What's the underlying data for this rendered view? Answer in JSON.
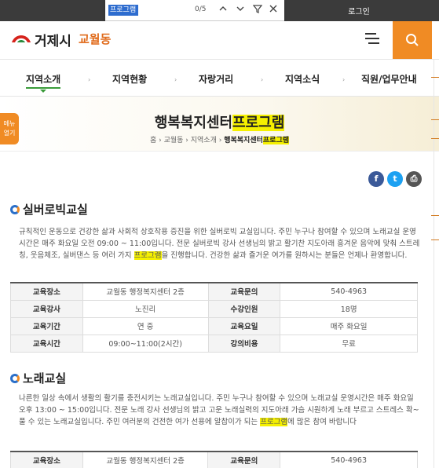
{
  "topbar": {
    "login_label": "로그인"
  },
  "findbar": {
    "query": "프로그램",
    "count": "0/5"
  },
  "header": {
    "city": "거제시",
    "dong": "교월동"
  },
  "nav": {
    "items": [
      "지역소개",
      "지역현황",
      "자랑거리",
      "지역소식",
      "직원/업무안내"
    ]
  },
  "hero": {
    "menu_tab": [
      "메뉴",
      "열기"
    ],
    "title_pre": "행복복지센터",
    "title_hl": "프로그램",
    "breadcrumb": [
      "홈",
      "교월동",
      "지역소개"
    ],
    "breadcrumb_current_pre": "행복복지센터",
    "breadcrumb_current_hl": "프로그램"
  },
  "share": {
    "facebook": "f",
    "twitter": "t",
    "print": "⎙"
  },
  "sections": [
    {
      "title": "실버로빅교실",
      "text_pre": "규칙적인 운동으로 건강한 삶과 사회적 상호작용 증진을 위한 실버로빅 교실입니다. 주민 누구나 참여할 수 있으며 노래교실 운영시간은 매주 화요일 오전 09:00 ~ 11:00입니다. 전문 실버로빅 강사 선생님의 밝고 활기찬 지도아래 흥겨운 음악에 맞춰 스트레칭, 웃음체조, 실버댄스 등 여러 가지 ",
      "text_hl": "프로그램",
      "text_post": "을 진행합니다. 건강한 삶과 즐거운 여가를 원하시는 분들은 언제나 환영합니다.",
      "rows": [
        [
          "교육장소",
          "교월동 행정복지센터 2층",
          "교육문의",
          "540-4963"
        ],
        [
          "교육강사",
          "노진리",
          "수강인원",
          "18명"
        ],
        [
          "교육기간",
          "연 중",
          "교육요일",
          "매주 화요일"
        ],
        [
          "교육시간",
          "09:00~11:00(2시간)",
          "강의비용",
          "무료"
        ]
      ]
    },
    {
      "title": "노래교실",
      "text_pre": "나른한 일상 속에서 생활의 활기를 충전시키는 노래교실입니다. 주민 누구나 참여할 수 있으며 노래교실 운영시간은 매주 화요일 오후 13:00 ~ 15:00입니다. 전문 노래 강사 선생님의 밝고 고운 노래실력의 지도아래 가슴 시원하게 노래 부르고 스트레스 확~ 풀 수 있는 노래교실입니다. 주민 여러분의 건전한 여가 선용에 알찹이가 되는 ",
      "text_hl": "프로그램",
      "text_post": "에 많은 참여 바랍니다",
      "rows": [
        [
          "교육장소",
          "교월동 행정복지센터 2층",
          "교육문의",
          "540-4963"
        ]
      ]
    }
  ]
}
